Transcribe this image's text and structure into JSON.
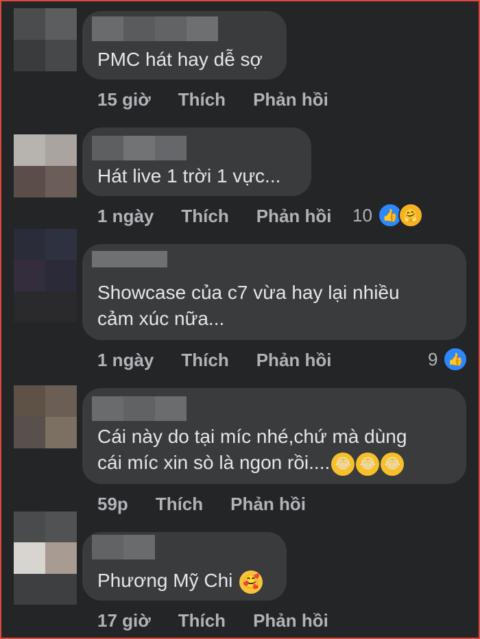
{
  "comments": [
    {
      "text": "PMC hát hay dễ sợ",
      "time": "15 giờ",
      "like": "Thích",
      "reply": "Phản hồi",
      "avatar_colors": [
        "#4b4c4e",
        "#5c5d5f",
        "#3a3b3c",
        "#47484a"
      ],
      "name_colors": [
        "#6a6b6d",
        "#5a5b5d",
        "#626365",
        "#6e6f71",
        "#58595b"
      ]
    },
    {
      "text": "Hát live 1 trời 1 vực...",
      "time": "1 ngày",
      "like": "Thích",
      "reply": "Phản hồi",
      "reaction_count": "10",
      "reaction_icons": [
        "like-icon",
        "care-icon"
      ],
      "avatar_colors": [
        "#b7b3ae",
        "#a9a4a0",
        "#5b4d4a",
        "#6b5d57"
      ],
      "name_colors": [
        "#5e5f61",
        "#727375",
        "#66676a",
        "#5a5b5e"
      ]
    },
    {
      "text": "Showcase của c7 vừa hay lại nhiều\ncảm xúc nữa...",
      "time": "1 ngày",
      "like": "Thích",
      "reply": "Phản hồi",
      "reaction_count": "9",
      "reaction_icons": [
        "like-icon"
      ],
      "avatar_colors": [
        "#2a2c3a",
        "#2e3140",
        "#332d3d",
        "#2b2a38"
      ],
      "name_colors": [
        "#6f7072",
        "#707173",
        "#6c6d6f"
      ]
    },
    {
      "text": "Cái này do tại míc nhé,chứ mà dùng\ncái míc xin sò là ngon rồi....",
      "time": "59p",
      "like": "Thích",
      "reply": "Phản hồi",
      "inline_emojis": [
        "laugh-cry-icon",
        "laugh-cry-icon",
        "laugh-cry-icon"
      ],
      "avatar_colors": [
        "#5e5146",
        "#6b5e55",
        "#57504d",
        "#7c7063"
      ],
      "name_colors": [
        "#6a6b6d",
        "#616264",
        "#6b6c6e",
        "#5c5d5f"
      ]
    },
    {
      "text": "Phương Mỹ Chi",
      "time": "17 giờ",
      "like": "Thích",
      "reply": "Phản hồi",
      "inline_emojis": [
        "smiling-hearts-icon"
      ],
      "avatar_colors": [
        "#4a4b4d",
        "#515254",
        "#d8d4cf",
        "#a89b92"
      ],
      "name_colors": [
        "#626365",
        "#6a6b6d"
      ]
    }
  ]
}
